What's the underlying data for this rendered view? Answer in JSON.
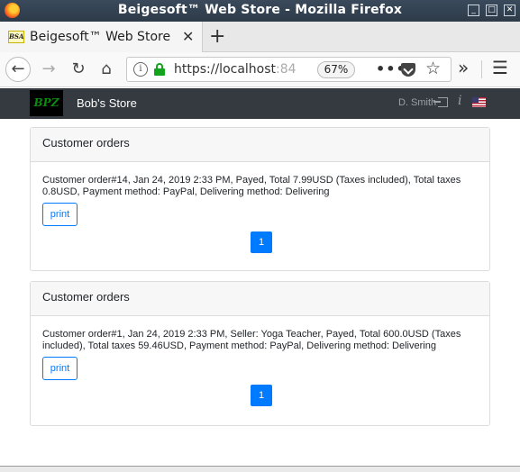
{
  "window": {
    "title": "Beigesoft™ Web Store - Mozilla Firefox"
  },
  "tab": {
    "favicon_text": "BSA",
    "title": "Beigesoft™ Web Store"
  },
  "navbar": {
    "url_main": "https://localhost",
    "url_fade": ":84",
    "zoom": "67%"
  },
  "site": {
    "logo_text": "BPZ",
    "store_name": "Bob's Store",
    "user_name": "D. Smith"
  },
  "orders": [
    {
      "header": "Customer orders",
      "text": "Customer order#14, Jan 24, 2019 2:33 PM, Payed, Total 7.99USD (Taxes included), Total taxes 0.8USD, Payment method: PayPal, Delivering method: Delivering",
      "print_label": "print",
      "page": "1"
    },
    {
      "header": "Customer orders",
      "text": "Customer order#1, Jan 24, 2019 2:33 PM, Seller: Yoga Teacher, Payed, Total 600.0USD (Taxes included), Total taxes 59.46USD, Payment method: PayPal, Delivering method: Delivering",
      "print_label": "print",
      "page": "1"
    }
  ],
  "colors": {
    "primary": "#007bff",
    "header_bg": "#343a40"
  }
}
